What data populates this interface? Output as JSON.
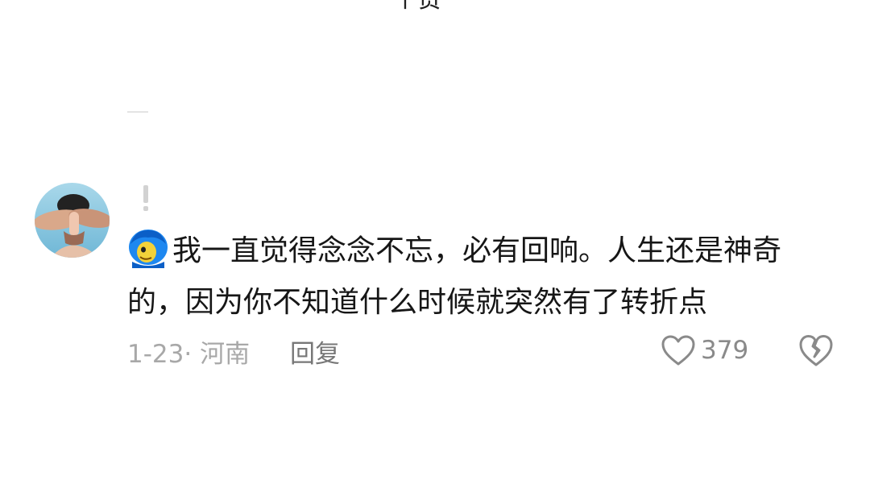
{
  "header": {
    "top_cut_label": "个赞"
  },
  "comment": {
    "avatar_icon": "user-avatar",
    "nickname_icon": "exclamation-mark-icon",
    "emoji_icon": "blue-hair-character-emoji",
    "text": "我一直觉得念念不忘，必有回响。人生还是神奇的，因为你不知道什么时候就突然有了转折点",
    "date_location": "1-23· 河南",
    "reply_label": "回复",
    "like_icon": "heart-outline-icon",
    "like_count": "379",
    "dislike_icon": "broken-heart-icon"
  },
  "colors": {
    "text": "#161616",
    "meta": "#a8a8a8",
    "icon": "#8a8a8a"
  }
}
